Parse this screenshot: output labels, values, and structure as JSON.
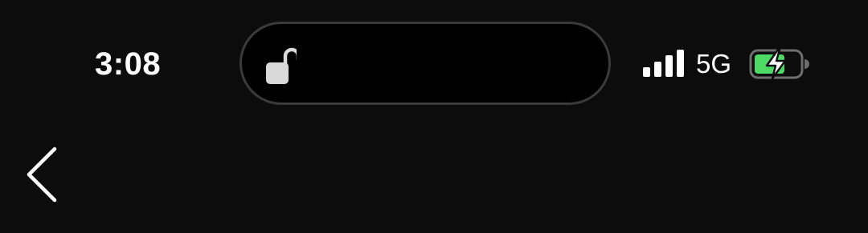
{
  "status_bar": {
    "time": "3:08",
    "network": "5G",
    "battery_charging": true,
    "battery_color": "#4cd964",
    "lock_state": "unlocked"
  },
  "icons": {
    "lock": "lock-open-icon",
    "signal": "cellular-signal-icon",
    "battery": "battery-charging-icon",
    "back": "chevron-left-icon"
  },
  "colors": {
    "background": "#0c0c0c",
    "island_border": "#3a3a3a",
    "foreground": "#ffffff"
  }
}
